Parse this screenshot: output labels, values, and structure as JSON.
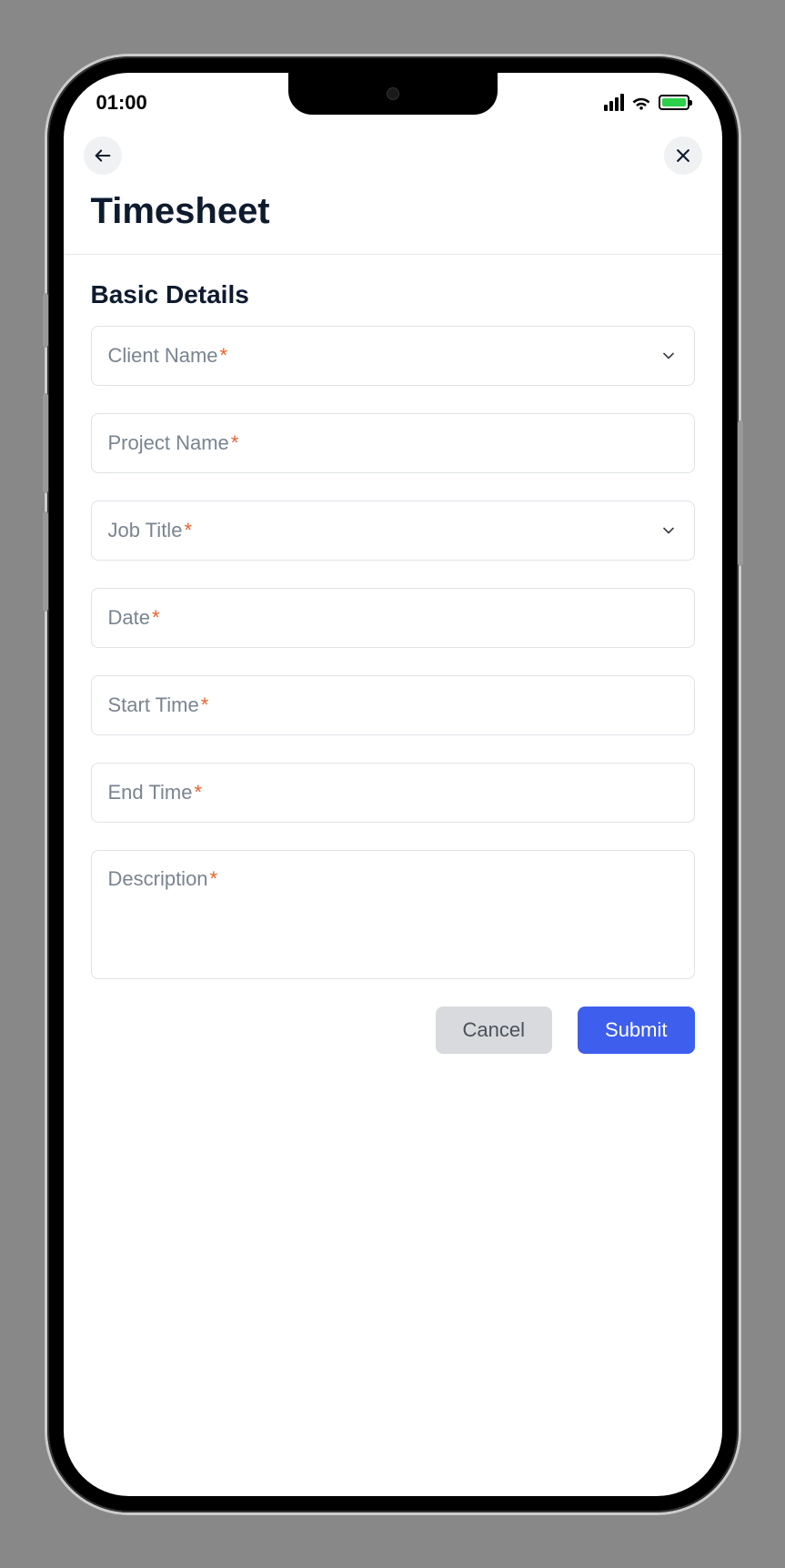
{
  "status_bar": {
    "time": "01:00"
  },
  "page": {
    "title": "Timesheet",
    "section_title": "Basic Details"
  },
  "fields": {
    "client_name": {
      "label": "Client Name",
      "required": "*",
      "type": "select"
    },
    "project_name": {
      "label": "Project Name",
      "required": "*",
      "type": "text"
    },
    "job_title": {
      "label": "Job Title",
      "required": "*",
      "type": "select"
    },
    "date": {
      "label": "Date",
      "required": "*",
      "type": "date"
    },
    "start_time": {
      "label": "Start Time",
      "required": "*",
      "type": "time"
    },
    "end_time": {
      "label": "End Time",
      "required": "*",
      "type": "time"
    },
    "description": {
      "label": "Description",
      "required": "*",
      "type": "textarea"
    }
  },
  "buttons": {
    "cancel": "Cancel",
    "submit": "Submit"
  }
}
